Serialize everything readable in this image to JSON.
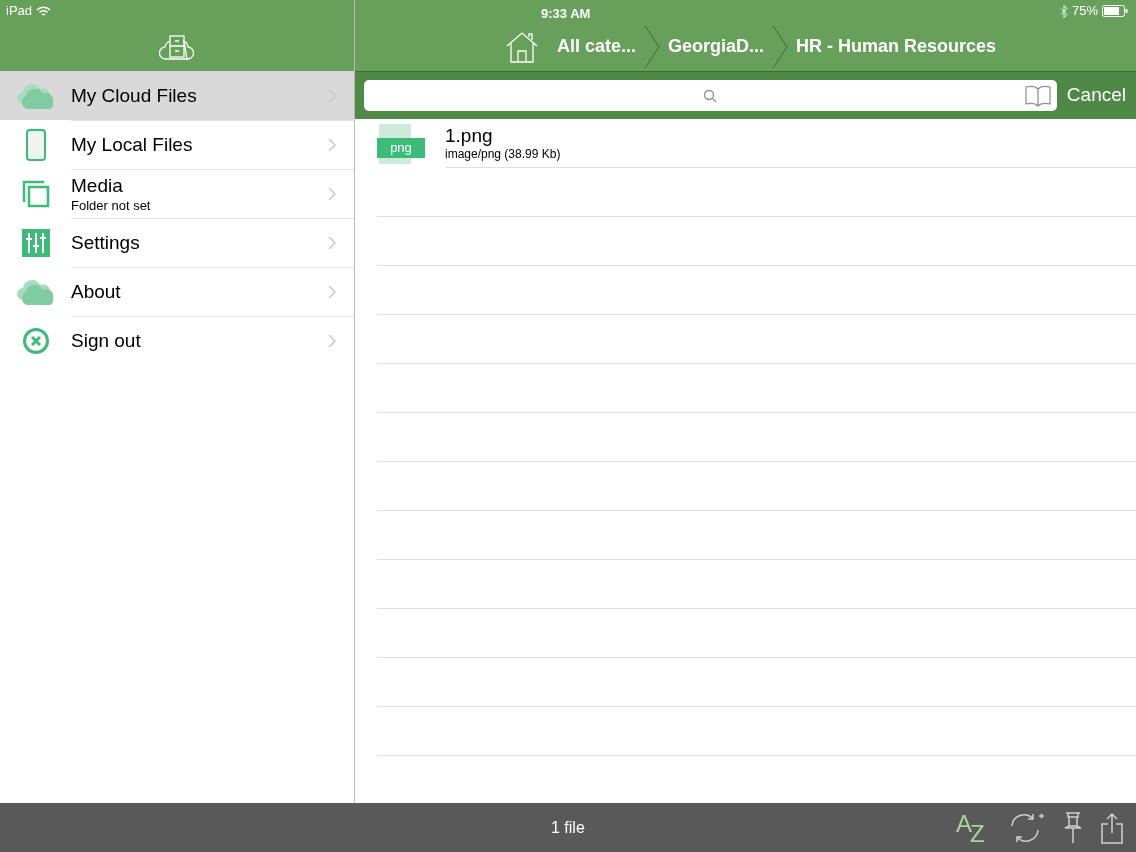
{
  "status_bar": {
    "device": "iPad",
    "time": "9:33 AM",
    "battery": "75%"
  },
  "breadcrumbs": [
    {
      "label": "All cate..."
    },
    {
      "label": "GeorgiaD..."
    },
    {
      "label": "HR - Human Resources"
    }
  ],
  "sidebar": {
    "items": [
      {
        "kind": "cloud",
        "label": "My Cloud Files",
        "selected": true
      },
      {
        "kind": "phone",
        "label": "My Local Files",
        "selected": false
      },
      {
        "kind": "media",
        "label": "Media",
        "subtitle": "Folder not set",
        "selected": false
      },
      {
        "kind": "settings",
        "label": "Settings",
        "selected": false
      },
      {
        "kind": "cloud",
        "label": "About",
        "selected": false
      },
      {
        "kind": "signout",
        "label": "Sign out",
        "selected": false
      }
    ]
  },
  "search": {
    "cancel": "Cancel"
  },
  "files": [
    {
      "badge": "png",
      "name": "1.png",
      "detail": "image/png (38.99 Kb)"
    }
  ],
  "footer": {
    "count": "1 file",
    "sort_glyphs": [
      "A",
      "Z"
    ]
  }
}
